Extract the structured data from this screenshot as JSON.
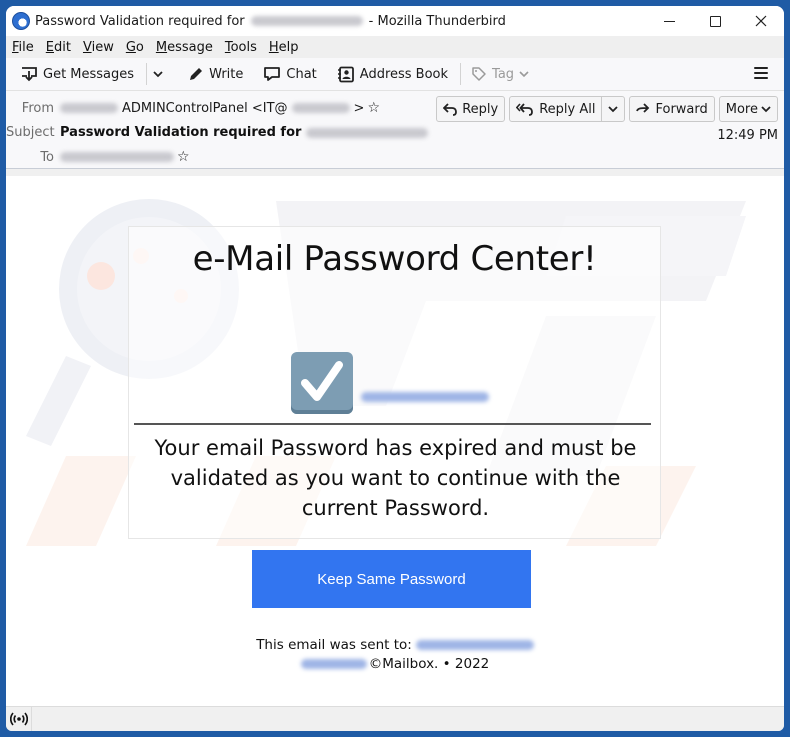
{
  "window": {
    "title_prefix": "Password Validation required for",
    "title_suffix": "- Mozilla Thunderbird"
  },
  "menubar": {
    "items": [
      {
        "key": "F",
        "rest": "ile"
      },
      {
        "key": "E",
        "rest": "dit"
      },
      {
        "key": "V",
        "rest": "iew"
      },
      {
        "key": "G",
        "rest": "o"
      },
      {
        "key": "M",
        "rest": "essage"
      },
      {
        "key": "T",
        "rest": "ools"
      },
      {
        "key": "H",
        "rest": "elp"
      }
    ]
  },
  "toolbar": {
    "get_messages": "Get Messages",
    "write": "Write",
    "chat": "Chat",
    "address_book": "Address Book",
    "tag": "Tag"
  },
  "header": {
    "from_label": "From",
    "from_name": "ADMINControlPanel <IT@",
    "from_close": ">",
    "subject_label": "Subject",
    "subject": "Password Validation required for",
    "to_label": "To",
    "time": "12:49 PM",
    "actions": {
      "reply": "Reply",
      "reply_all": "Reply All",
      "forward": "Forward",
      "more": "More"
    }
  },
  "email": {
    "title": "e-Mail Password Center!",
    "message": "Your email Password has expired and must be validated as you want to continue with the current Password.",
    "button": "Keep Same Password",
    "sent_to": "This email was sent to:",
    "copyright": "©Mailbox. • 2022",
    "accent_color": "#3275f0"
  }
}
